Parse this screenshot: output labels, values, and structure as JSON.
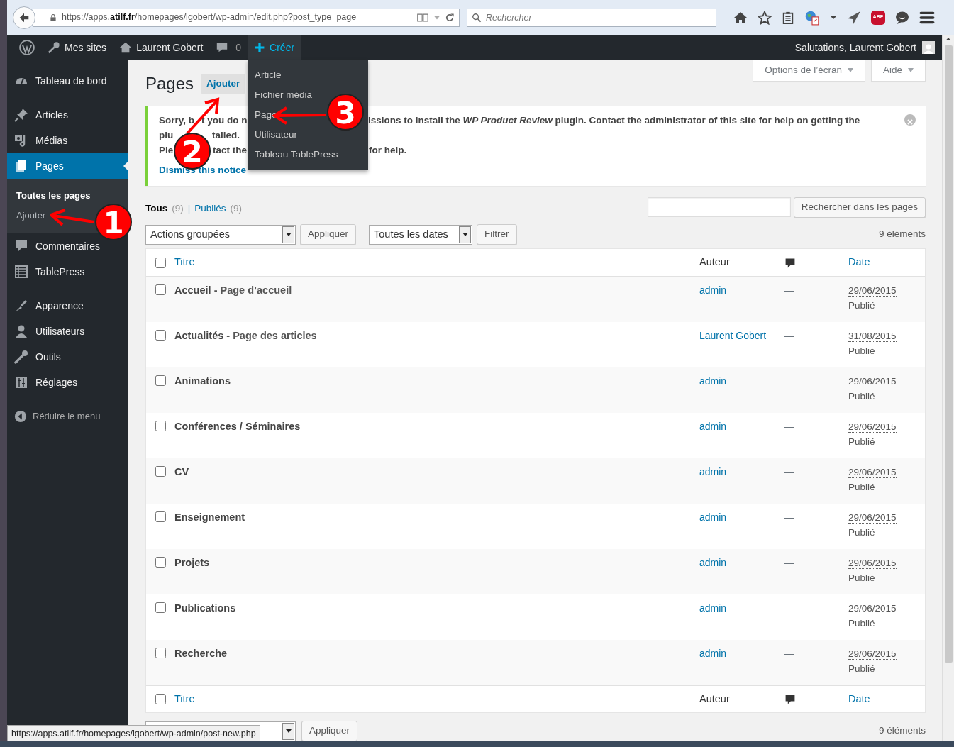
{
  "browser": {
    "url": "https://apps.**atilf.fr**/homepages/lgobert/wp-admin/edit.php?post_type=page",
    "search_placeholder": "Rechercher",
    "abp_label": "ABP"
  },
  "admin_bar": {
    "sites": "Mes sites",
    "site_name": "Laurent Gobert",
    "comments": "0",
    "new": "Créer",
    "new_expanded": true,
    "greeting": "Salutations, Laurent Gobert"
  },
  "new_menu": [
    "Article",
    "Fichier média",
    "Page",
    "Utilisateur",
    "Tableau TablePress"
  ],
  "screen_tabs": [
    "Options de l’écran",
    "Aide"
  ],
  "sidebar": {
    "groups": [
      [
        {
          "label": "Tableau de bord",
          "selected": false
        }
      ],
      [
        {
          "label": "Articles",
          "selected": false
        },
        {
          "label": "Médias",
          "selected": false
        },
        {
          "label": "Pages",
          "selected": true,
          "children": [
            {
              "label": "Toutes les pages",
              "selected": true
            },
            {
              "label": "Ajouter",
              "selected": false
            }
          ]
        },
        {
          "label": "Commentaires",
          "selected": false
        },
        {
          "label": "TablePress",
          "selected": false
        }
      ],
      [
        {
          "label": "Apparence",
          "selected": false
        },
        {
          "label": "Utilisateurs",
          "selected": false
        },
        {
          "label": "Outils",
          "selected": false
        },
        {
          "label": "Réglages",
          "selected": false
        }
      ]
    ],
    "collapse": "Réduire le menu"
  },
  "page": {
    "title": "Pages",
    "add_button": "Ajouter"
  },
  "notice": {
    "lines": [
      [
        "Sorry, b",
        "t you do n",
        "issions to install the *WP Product Review* plugin. Contact the administrator of this site for help on getting the"
      ],
      [
        "plu",
        "talled."
      ],
      [
        "Ple",
        "tact the",
        "for help."
      ]
    ],
    "dismiss": "Dismiss this notice"
  },
  "filters": {
    "views": [
      {
        "label": "Tous",
        "count": "(9)",
        "selected": true
      },
      {
        "label": "Publiés",
        "count": "(9)",
        "selected": false
      }
    ],
    "separator": "|",
    "search_button": "Rechercher dans les pages",
    "bulk_select": "Actions groupées",
    "apply": "Appliquer",
    "date_select": "Toutes les dates",
    "filter": "Filtrer",
    "count": "9 éléments"
  },
  "table": {
    "columns": {
      "select_all_checked": false,
      "title": "Titre",
      "author": "Auteur",
      "date": "Date"
    },
    "rows": [
      {
        "title": "Accueil",
        "state": "- Page d’accueil",
        "author": "admin",
        "comments": "—",
        "date": "29/06/2015",
        "status": "Publié",
        "checked": false
      },
      {
        "title": "Actualités",
        "state": "- Page des articles",
        "author": "Laurent Gobert",
        "comments": "—",
        "date": "31/08/2015",
        "status": "Publié",
        "checked": false
      },
      {
        "title": "Animations",
        "author": "admin",
        "comments": "—",
        "date": "29/06/2015",
        "status": "Publié",
        "checked": false
      },
      {
        "title": "Conférences / Séminaires",
        "author": "admin",
        "comments": "—",
        "date": "29/06/2015",
        "status": "Publié",
        "checked": false
      },
      {
        "title": "CV",
        "author": "admin",
        "comments": "—",
        "date": "29/06/2015",
        "status": "Publié",
        "checked": false
      },
      {
        "title": "Enseignement",
        "author": "admin",
        "comments": "—",
        "date": "29/06/2015",
        "status": "Publié",
        "checked": false
      },
      {
        "title": "Projets",
        "author": "admin",
        "comments": "—",
        "date": "29/06/2015",
        "status": "Publié",
        "checked": false
      },
      {
        "title": "Publications",
        "author": "admin",
        "comments": "—",
        "date": "29/06/2015",
        "status": "Publié",
        "checked": false
      },
      {
        "title": "Recherche",
        "author": "admin",
        "comments": "—",
        "date": "29/06/2015",
        "status": "Publié",
        "checked": false
      }
    ],
    "footer_columns": {
      "select_all_checked": false,
      "title": "Titre",
      "author": "Auteur",
      "date": "Date"
    }
  },
  "bottom": {
    "apply": "Appliquer",
    "count": "9 éléments"
  },
  "status_url": "https://apps.atilf.fr/homepages/lgobert/wp-admin/post-new.php",
  "annotations": [
    {
      "number": "1"
    },
    {
      "number": "2"
    },
    {
      "number": "3"
    }
  ]
}
